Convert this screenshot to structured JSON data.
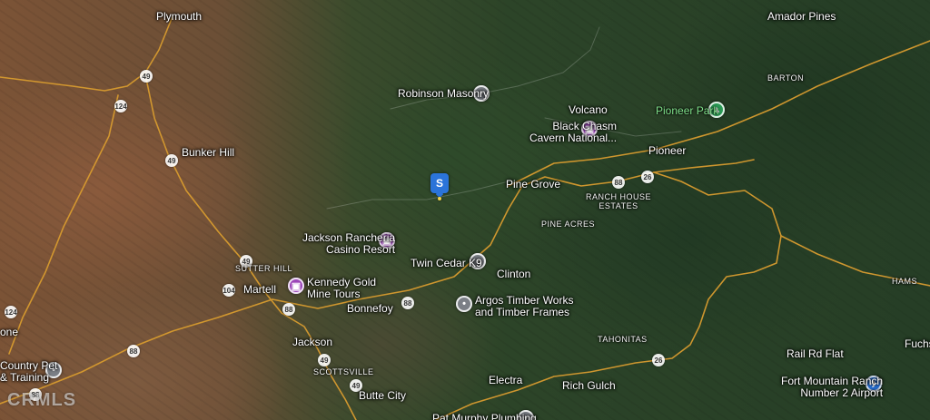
{
  "map": {
    "place_labels": [
      {
        "key": "plymouth",
        "text": "Plymouth"
      },
      {
        "key": "amador_pines",
        "text": "Amador Pines"
      },
      {
        "key": "barton",
        "text": "BARTON"
      },
      {
        "key": "robinson_masonry",
        "text": "Robinson Masonry"
      },
      {
        "key": "volcano",
        "text": "Volcano"
      },
      {
        "key": "black_chasm",
        "text": "Black Chasm\nCavern National..."
      },
      {
        "key": "pioneer_park",
        "text": "Pioneer Park"
      },
      {
        "key": "bunker_hill",
        "text": "Bunker Hill"
      },
      {
        "key": "pioneer",
        "text": "Pioneer"
      },
      {
        "key": "pine_grove",
        "text": "Pine Grove"
      },
      {
        "key": "ranch_house_estates",
        "text": "RANCH HOUSE\nESTATES"
      },
      {
        "key": "pine_acres",
        "text": "PINE ACRES"
      },
      {
        "key": "jackson_rancheria",
        "text": "Jackson Rancheria\nCasino Resort"
      },
      {
        "key": "twin_cedar_k9",
        "text": "Twin Cedar K9"
      },
      {
        "key": "clinton",
        "text": "Clinton"
      },
      {
        "key": "sutter_hill",
        "text": "SUTTER HILL"
      },
      {
        "key": "martell",
        "text": "Martell"
      },
      {
        "key": "kennedy_gold",
        "text": "Kennedy Gold\nMine Tours"
      },
      {
        "key": "argos_timber",
        "text": "Argos Timber Works\nand Timber Frames"
      },
      {
        "key": "bonnefoy",
        "text": "Bonnefoy"
      },
      {
        "key": "jackson",
        "text": "Jackson"
      },
      {
        "key": "scottsville",
        "text": "SCOTTSVILLE"
      },
      {
        "key": "tahonitas",
        "text": "TAHONITAS"
      },
      {
        "key": "hams",
        "text": "HAMS"
      },
      {
        "key": "rail_rd_flat",
        "text": "Rail Rd Flat"
      },
      {
        "key": "fuchs",
        "text": "Fuchs"
      },
      {
        "key": "fort_mountain",
        "text": "Fort Mountain Ranch\nNumber 2 Airport"
      },
      {
        "key": "country_pet",
        "text": "Country Pet\n& Training"
      },
      {
        "key": "one",
        "text": "one"
      },
      {
        "key": "electra",
        "text": "Electra"
      },
      {
        "key": "rich_gulch",
        "text": "Rich Gulch"
      },
      {
        "key": "butte_city",
        "text": "Butte City"
      },
      {
        "key": "pat_murphy",
        "text": "Pat Murphy Plumbing"
      }
    ],
    "route_shields": [
      "49",
      "124",
      "49",
      "49",
      "88",
      "26",
      "88",
      "88",
      "104",
      "124",
      "88",
      "49",
      "49",
      "88",
      "26"
    ],
    "selected_marker": {
      "letter": "S"
    },
    "watermark": "CRMLS",
    "colors": {
      "road": "#d79b2f",
      "poi_gray": "#7b7f86",
      "poi_purple": "#9c46b8",
      "poi_green": "#2b9a55",
      "marker_blue": "#2b74d9"
    },
    "icons": {
      "poi_gray": "location-pin-icon",
      "poi_purple": "attraction-icon",
      "poi_green": "park-icon",
      "airport": "airport-icon",
      "marker": "selected-property-marker-icon"
    }
  }
}
